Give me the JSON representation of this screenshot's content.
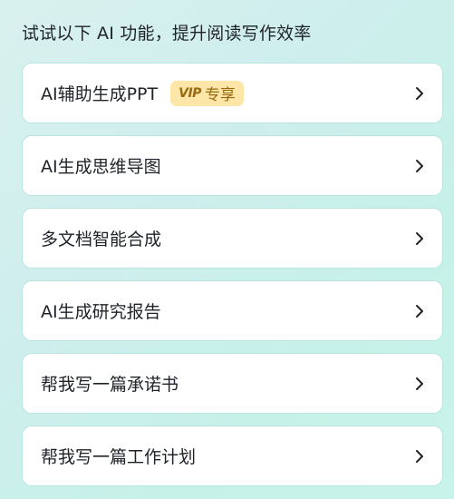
{
  "header": {
    "title": "试试以下 AI 功能，提升阅读写作效率"
  },
  "items": [
    {
      "label": "AI辅助生成PPT",
      "badge": {
        "logo": "VIP",
        "text": "专享"
      }
    },
    {
      "label": "AI生成思维导图"
    },
    {
      "label": "多文档智能合成"
    },
    {
      "label": "AI生成研究报告"
    },
    {
      "label": "帮我写一篇承诺书"
    },
    {
      "label": "帮我写一篇工作计划"
    }
  ],
  "icons": {
    "chevron": "chevron-right-icon"
  },
  "colors": {
    "text": "#1f2329",
    "badge_bg": "#fde6a8",
    "badge_text": "#9a6a10",
    "card_border": "#b8e6de"
  }
}
